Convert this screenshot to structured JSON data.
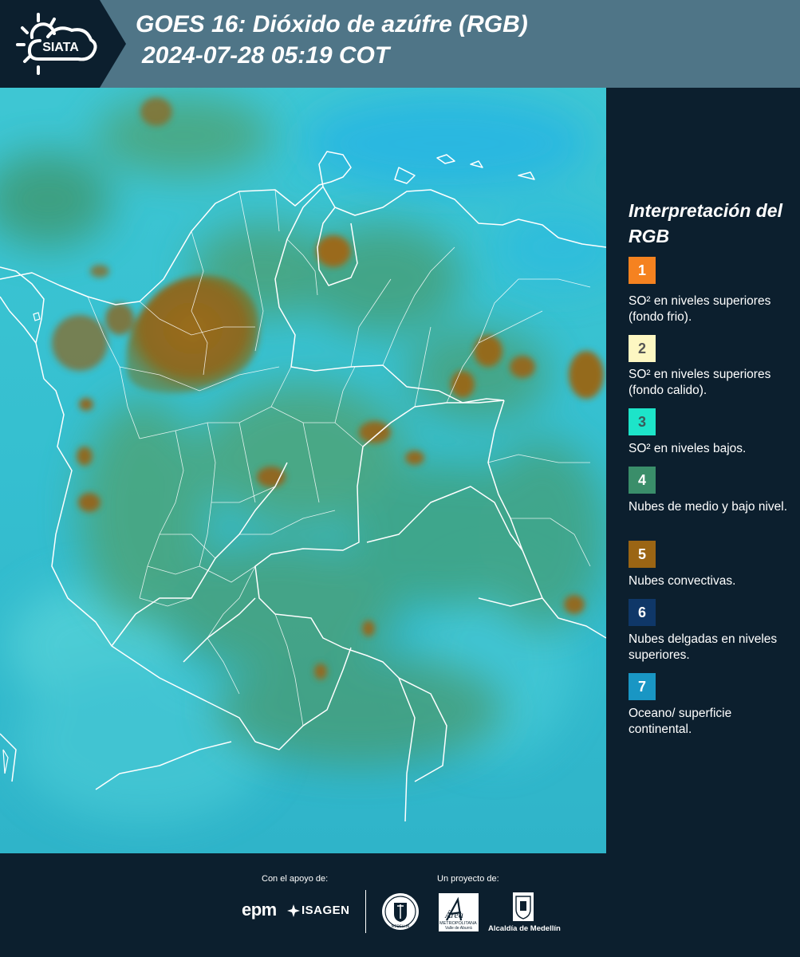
{
  "header": {
    "logo_text": "SIATA",
    "title_line1": "GOES 16: Dióxido de azúfre (RGB)",
    "title_line2": "2024-07-28 05:19 COT"
  },
  "legend": {
    "title": "Interpretación del RGB",
    "items": [
      {
        "number": "1",
        "color": "#f58220",
        "text_color": "#ffffff",
        "label": "SO² en niveles superiores (fondo frio)."
      },
      {
        "number": "2",
        "color": "#fdf7c2",
        "text_color": "#555555",
        "label": "SO² en niveles superiores (fondo calido)."
      },
      {
        "number": "3",
        "color": "#1de4c9",
        "text_color": "#3a5b5a",
        "label": "SO² en niveles bajos."
      },
      {
        "number": "4",
        "color": "#3a8e6a",
        "text_color": "#ffffff",
        "label": "Nubes de medio y bajo nivel."
      },
      {
        "number": "5",
        "color": "#9b6514",
        "text_color": "#ffffff",
        "label": "Nubes convectivas."
      },
      {
        "number": "6",
        "color": "#0f3768",
        "text_color": "#ffffff",
        "label": "Nubes delgadas en niveles superiores."
      },
      {
        "number": "7",
        "color": "#1996c4",
        "text_color": "#ffffff",
        "label": "Oceano/ superficie continental."
      }
    ]
  },
  "footer": {
    "support_label": "Con el apoyo de:",
    "project_label": "Un proyecto de:",
    "sponsor_epm": "epm",
    "sponsor_isagen": "ISAGEN",
    "area_name": "Área",
    "area_sub1": "METROPOLITANA",
    "area_sub2": "Valle de Aburrá",
    "alcaldia": "Alcaldía de Medellín",
    "medellin_seal_text": "MEDELLIN"
  }
}
